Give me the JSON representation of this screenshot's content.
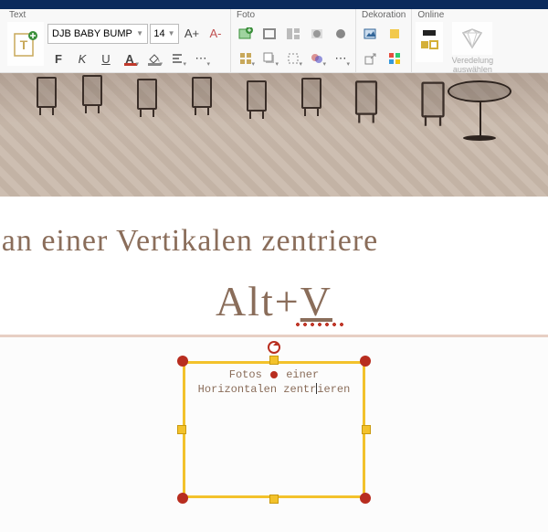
{
  "ribbon": {
    "groups": {
      "text": {
        "label": "Text"
      },
      "foto": {
        "label": "Foto"
      },
      "dekoration": {
        "label": "Dekoration"
      },
      "online": {
        "label": "Online",
        "veredelung": "Veredelung auswählen"
      }
    },
    "font": {
      "name": "DJB BABY BUMP",
      "size": "14"
    },
    "buttons": {
      "inc": "A+",
      "dec": "A-",
      "bold": "F",
      "italic": "K",
      "underline": "U"
    }
  },
  "canvas": {
    "line1": "os an einer Vertikalen zentriere",
    "shortcut": "Alt+",
    "shortcut_key": "V",
    "sel_line1a": "Fotos",
    "sel_line1b": "einer",
    "sel_line2a": "Horizontalen zentr",
    "sel_line2b": "ieren"
  }
}
